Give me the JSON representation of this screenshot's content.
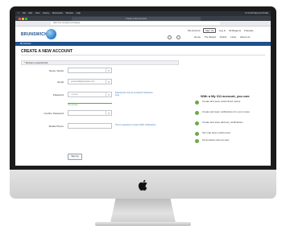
{
  "browser": {
    "menubar": [
      "File",
      "Edit",
      "View",
      "History",
      "Bookmarks",
      "Window",
      "Help"
    ],
    "menubar_right": "Fri 12:00  My2-111 Profile",
    "tab_title": "Create a New Account",
    "address": "https://my.company.com/signup"
  },
  "site": {
    "logo_text": "BRUNSWICK",
    "top_links": [
      "My Account",
      "Sign Up",
      "Log In",
      "All Regions",
      "Français"
    ],
    "nav_links": [
      "Home",
      "The Board",
      "NL311",
      "Links",
      "About Us"
    ],
    "breadcrumb": "My Account",
    "page_title": "CREATE A NEW ACCOUNT",
    "required_note": "* Denotes a required field"
  },
  "form": {
    "fields": [
      {
        "label": "Name / Entity",
        "value": "",
        "has_dropdown": true
      },
      {
        "label": "Email",
        "value": "youremail@example.com",
        "has_dropdown": true
      },
      {
        "label": "Password",
        "value": "••••••••••",
        "has_dropdown": true,
        "hint": "Passwords must be at least 8 characters long"
      },
      {
        "label": "Confirm Password",
        "value": "",
        "has_dropdown": true
      },
      {
        "label": "Mobile Phone",
        "value": "",
        "has_dropdown": false,
        "hint": "This is required to receive SMS notifications"
      }
    ],
    "strength_text": "Very strong",
    "submit_label": "Sign Up"
  },
  "benefits": {
    "title": "With a My 311 account, you can:",
    "items": [
      "Create and save customized routes",
      "Create and save notifications for your routes",
      "Create and save advisory notifications",
      "Set map layer preferences",
      "Personalize camera view"
    ],
    "bullet_color": "#6fa84a"
  },
  "device": {
    "apple_logo": "apple-icon"
  }
}
